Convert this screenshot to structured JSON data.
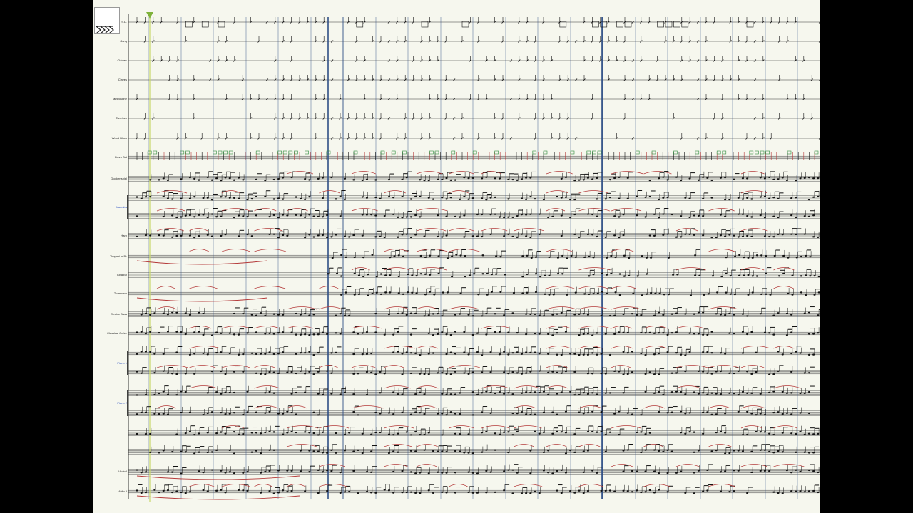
{
  "colors": {
    "paper": "#f6f7ee",
    "staff": "#333333",
    "barline": "#2f4f86",
    "cursor": "#c8d86a",
    "slur": "#b43a3a",
    "note": "#111111",
    "drum_green": "#2e8b3c",
    "label_blue": "#2a4fbf"
  },
  "app": {
    "logo_icon": "triple-arrow-logo-icon"
  },
  "score": {
    "playhead_icon": "green-triangle-playhead-icon",
    "instruments": [
      {
        "label": "S.D.",
        "kind": "perc",
        "color": ""
      },
      {
        "label": "Gong",
        "kind": "perc",
        "color": ""
      },
      {
        "label": "Chimes",
        "kind": "perc",
        "color": ""
      },
      {
        "label": "Claves",
        "kind": "perc",
        "color": ""
      },
      {
        "label": "Tambourine",
        "kind": "perc",
        "color": ""
      },
      {
        "label": "Tam-tam",
        "kind": "perc",
        "color": ""
      },
      {
        "label": "Wood Block",
        "kind": "perc",
        "color": ""
      },
      {
        "label": "Drum Set",
        "kind": "drum",
        "color": ""
      },
      {
        "label": "Glockenspiel",
        "kind": "pitched",
        "color": ""
      },
      {
        "label": "Marimba",
        "kind": "grand",
        "color": "blue"
      },
      {
        "label": "Harp",
        "kind": "pitched",
        "color": ""
      },
      {
        "label": "Timpani in B♭",
        "kind": "pitched",
        "color": ""
      },
      {
        "label": "Tuba Bb",
        "kind": "pitched",
        "color": ""
      },
      {
        "label": "Trombone",
        "kind": "pitched",
        "color": ""
      },
      {
        "label": "Electric Bass",
        "kind": "pitched",
        "color": ""
      },
      {
        "label": "Classical Guitar",
        "kind": "pitched",
        "color": ""
      },
      {
        "label": "Piano 1",
        "kind": "grand",
        "color": "blue"
      },
      {
        "label": "Piano 2",
        "kind": "grand",
        "color": "blue"
      },
      {
        "label": "",
        "kind": "pitched",
        "color": ""
      },
      {
        "label": "",
        "kind": "pitched",
        "color": ""
      },
      {
        "label": "Violin I",
        "kind": "pitched",
        "color": ""
      },
      {
        "label": "Violin II",
        "kind": "pitched",
        "color": ""
      }
    ]
  }
}
